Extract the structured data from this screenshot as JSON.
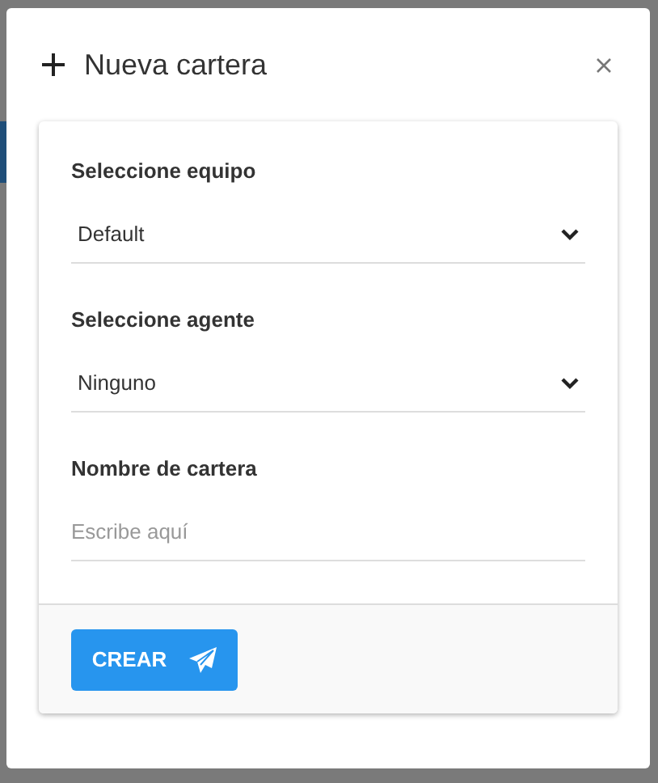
{
  "dialog": {
    "title": "Nueva cartera",
    "fields": [
      {
        "kind": "select",
        "label": "Seleccione equipo",
        "value": "Default"
      },
      {
        "kind": "select",
        "label": "Seleccione agente",
        "value": "Ninguno"
      },
      {
        "kind": "text",
        "label": "Nombre de cartera",
        "placeholder": "Escribe aquí"
      }
    ],
    "submit_button": "CREAR"
  }
}
